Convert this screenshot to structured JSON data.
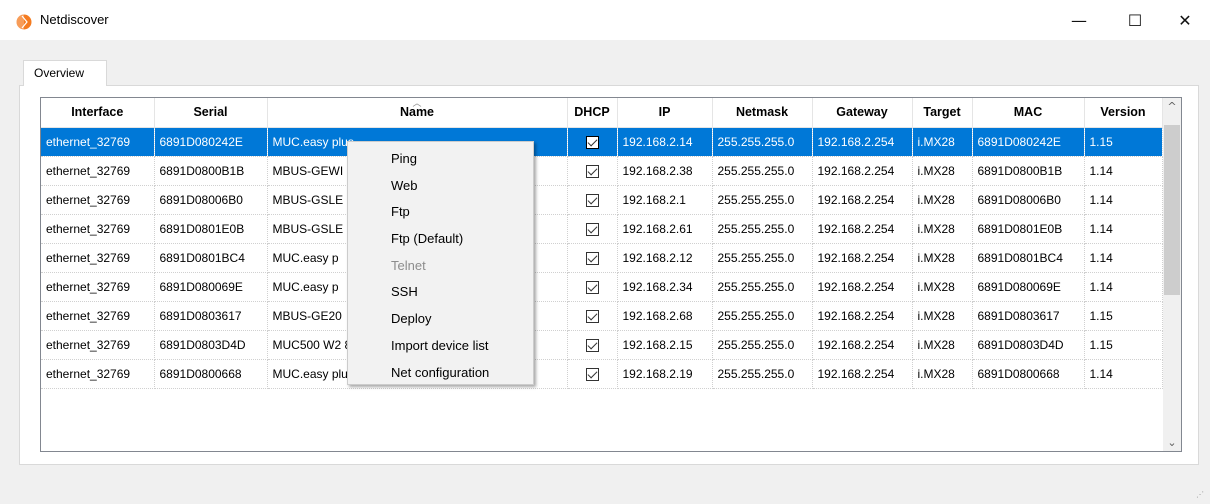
{
  "window": {
    "title": "Netdiscover",
    "minimize": "—",
    "maximize": "☐",
    "close": "✕"
  },
  "tab": {
    "label": "Overview"
  },
  "table": {
    "columns": [
      "Interface",
      "Serial",
      "Name",
      "DHCP",
      "IP",
      "Netmask",
      "Gateway",
      "Target",
      "MAC",
      "Version"
    ],
    "rows": [
      {
        "interface": "ethernet_32769",
        "serial": "6891D080242E",
        "name": "MUC.easy plus",
        "dhcp": true,
        "ip": "192.168.2.14",
        "netmask": "255.255.255.0",
        "gateway": "192.168.2.254",
        "target": "i.MX28",
        "mac": "6891D080242E",
        "version": "1.15",
        "selected": true
      },
      {
        "interface": "ethernet_32769",
        "serial": "6891D0800B1B",
        "name": "MBUS-GEWI",
        "dhcp": true,
        "ip": "192.168.2.38",
        "netmask": "255.255.255.0",
        "gateway": "192.168.2.254",
        "target": "i.MX28",
        "mac": "6891D0800B1B",
        "version": "1.14"
      },
      {
        "interface": "ethernet_32769",
        "serial": "6891D08006B0",
        "name": "MBUS-GSLE",
        "dhcp": true,
        "ip": "192.168.2.1",
        "netmask": "255.255.255.0",
        "gateway": "192.168.2.254",
        "target": "i.MX28",
        "mac": "6891D08006B0",
        "version": "1.14"
      },
      {
        "interface": "ethernet_32769",
        "serial": "6891D0801E0B",
        "name": "MBUS-GSLE",
        "dhcp": true,
        "ip": "192.168.2.61",
        "netmask": "255.255.255.0",
        "gateway": "192.168.2.254",
        "target": "i.MX28",
        "mac": "6891D0801E0B",
        "version": "1.14"
      },
      {
        "interface": "ethernet_32769",
        "serial": "6891D0801BC4",
        "name": "MUC.easy p",
        "dhcp": true,
        "ip": "192.168.2.12",
        "netmask": "255.255.255.0",
        "gateway": "192.168.2.254",
        "target": "i.MX28",
        "mac": "6891D0801BC4",
        "version": "1.14"
      },
      {
        "interface": "ethernet_32769",
        "serial": "6891D080069E",
        "name": "MUC.easy p",
        "dhcp": true,
        "ip": "192.168.2.34",
        "netmask": "255.255.255.0",
        "gateway": "192.168.2.254",
        "target": "i.MX28",
        "mac": "6891D080069E",
        "version": "1.14"
      },
      {
        "interface": "ethernet_32769",
        "serial": "6891D0803617",
        "name": "MBUS-GE20",
        "dhcp": true,
        "ip": "192.168.2.68",
        "netmask": "255.255.255.0",
        "gateway": "192.168.2.254",
        "target": "i.MX28",
        "mac": "6891D0803617",
        "version": "1.15"
      },
      {
        "interface": "ethernet_32769",
        "serial": "6891D0803D4D",
        "name": "MUC500 W2 868/433",
        "dhcp": true,
        "ip": "192.168.2.15",
        "netmask": "255.255.255.0",
        "gateway": "192.168.2.254",
        "target": "i.MX28",
        "mac": "6891D0803D4D",
        "version": "1.15"
      },
      {
        "interface": "ethernet_32769",
        "serial": "6891D0800668",
        "name": "MUC.easy plus",
        "dhcp": true,
        "ip": "192.168.2.19",
        "netmask": "255.255.255.0",
        "gateway": "192.168.2.254",
        "target": "i.MX28",
        "mac": "6891D0800668",
        "version": "1.14"
      }
    ]
  },
  "context_menu": {
    "items": [
      {
        "label": "Ping",
        "enabled": true
      },
      {
        "label": "Web",
        "enabled": true
      },
      {
        "label": "Ftp",
        "enabled": true
      },
      {
        "label": "Ftp (Default)",
        "enabled": true
      },
      {
        "label": "Telnet",
        "enabled": false
      },
      {
        "label": "SSH",
        "enabled": true
      },
      {
        "label": "Deploy",
        "enabled": true
      },
      {
        "label": "Import device list",
        "enabled": true
      },
      {
        "label": "Net configuration",
        "enabled": true
      }
    ]
  },
  "colors": {
    "selection": "#0078d7",
    "app_icon": "#f47b20"
  }
}
